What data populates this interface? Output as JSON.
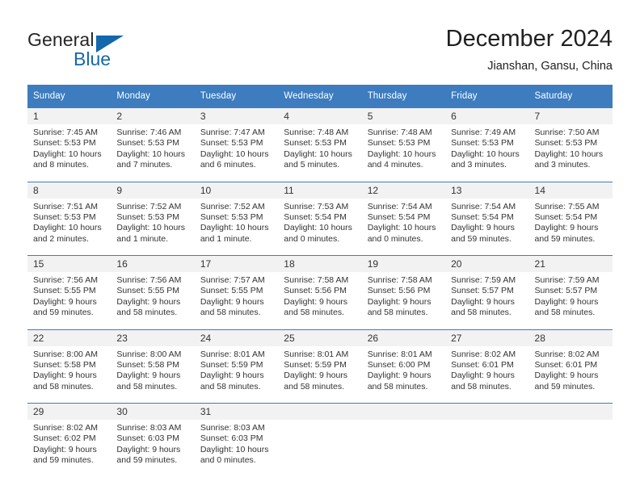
{
  "brand": {
    "name_top": "General",
    "name_bottom": "Blue",
    "triangle_color": "#1368ab"
  },
  "header": {
    "month_title": "December 2024",
    "location": "Jianshan, Gansu, China"
  },
  "theme": {
    "header_blue": "#3c7cbf",
    "daynum_background": "#f2f2f2",
    "text_color": "#333333"
  },
  "calendar": {
    "weekday_headers": [
      "Sunday",
      "Monday",
      "Tuesday",
      "Wednesday",
      "Thursday",
      "Friday",
      "Saturday"
    ],
    "weeks": [
      [
        {
          "day": "1",
          "sunrise": "Sunrise: 7:45 AM",
          "sunset": "Sunset: 5:53 PM",
          "daylight": "Daylight: 10 hours and 8 minutes."
        },
        {
          "day": "2",
          "sunrise": "Sunrise: 7:46 AM",
          "sunset": "Sunset: 5:53 PM",
          "daylight": "Daylight: 10 hours and 7 minutes."
        },
        {
          "day": "3",
          "sunrise": "Sunrise: 7:47 AM",
          "sunset": "Sunset: 5:53 PM",
          "daylight": "Daylight: 10 hours and 6 minutes."
        },
        {
          "day": "4",
          "sunrise": "Sunrise: 7:48 AM",
          "sunset": "Sunset: 5:53 PM",
          "daylight": "Daylight: 10 hours and 5 minutes."
        },
        {
          "day": "5",
          "sunrise": "Sunrise: 7:48 AM",
          "sunset": "Sunset: 5:53 PM",
          "daylight": "Daylight: 10 hours and 4 minutes."
        },
        {
          "day": "6",
          "sunrise": "Sunrise: 7:49 AM",
          "sunset": "Sunset: 5:53 PM",
          "daylight": "Daylight: 10 hours and 3 minutes."
        },
        {
          "day": "7",
          "sunrise": "Sunrise: 7:50 AM",
          "sunset": "Sunset: 5:53 PM",
          "daylight": "Daylight: 10 hours and 3 minutes."
        }
      ],
      [
        {
          "day": "8",
          "sunrise": "Sunrise: 7:51 AM",
          "sunset": "Sunset: 5:53 PM",
          "daylight": "Daylight: 10 hours and 2 minutes."
        },
        {
          "day": "9",
          "sunrise": "Sunrise: 7:52 AM",
          "sunset": "Sunset: 5:53 PM",
          "daylight": "Daylight: 10 hours and 1 minute."
        },
        {
          "day": "10",
          "sunrise": "Sunrise: 7:52 AM",
          "sunset": "Sunset: 5:53 PM",
          "daylight": "Daylight: 10 hours and 1 minute."
        },
        {
          "day": "11",
          "sunrise": "Sunrise: 7:53 AM",
          "sunset": "Sunset: 5:54 PM",
          "daylight": "Daylight: 10 hours and 0 minutes."
        },
        {
          "day": "12",
          "sunrise": "Sunrise: 7:54 AM",
          "sunset": "Sunset: 5:54 PM",
          "daylight": "Daylight: 10 hours and 0 minutes."
        },
        {
          "day": "13",
          "sunrise": "Sunrise: 7:54 AM",
          "sunset": "Sunset: 5:54 PM",
          "daylight": "Daylight: 9 hours and 59 minutes."
        },
        {
          "day": "14",
          "sunrise": "Sunrise: 7:55 AM",
          "sunset": "Sunset: 5:54 PM",
          "daylight": "Daylight: 9 hours and 59 minutes."
        }
      ],
      [
        {
          "day": "15",
          "sunrise": "Sunrise: 7:56 AM",
          "sunset": "Sunset: 5:55 PM",
          "daylight": "Daylight: 9 hours and 59 minutes."
        },
        {
          "day": "16",
          "sunrise": "Sunrise: 7:56 AM",
          "sunset": "Sunset: 5:55 PM",
          "daylight": "Daylight: 9 hours and 58 minutes."
        },
        {
          "day": "17",
          "sunrise": "Sunrise: 7:57 AM",
          "sunset": "Sunset: 5:55 PM",
          "daylight": "Daylight: 9 hours and 58 minutes."
        },
        {
          "day": "18",
          "sunrise": "Sunrise: 7:58 AM",
          "sunset": "Sunset: 5:56 PM",
          "daylight": "Daylight: 9 hours and 58 minutes."
        },
        {
          "day": "19",
          "sunrise": "Sunrise: 7:58 AM",
          "sunset": "Sunset: 5:56 PM",
          "daylight": "Daylight: 9 hours and 58 minutes."
        },
        {
          "day": "20",
          "sunrise": "Sunrise: 7:59 AM",
          "sunset": "Sunset: 5:57 PM",
          "daylight": "Daylight: 9 hours and 58 minutes."
        },
        {
          "day": "21",
          "sunrise": "Sunrise: 7:59 AM",
          "sunset": "Sunset: 5:57 PM",
          "daylight": "Daylight: 9 hours and 58 minutes."
        }
      ],
      [
        {
          "day": "22",
          "sunrise": "Sunrise: 8:00 AM",
          "sunset": "Sunset: 5:58 PM",
          "daylight": "Daylight: 9 hours and 58 minutes."
        },
        {
          "day": "23",
          "sunrise": "Sunrise: 8:00 AM",
          "sunset": "Sunset: 5:58 PM",
          "daylight": "Daylight: 9 hours and 58 minutes."
        },
        {
          "day": "24",
          "sunrise": "Sunrise: 8:01 AM",
          "sunset": "Sunset: 5:59 PM",
          "daylight": "Daylight: 9 hours and 58 minutes."
        },
        {
          "day": "25",
          "sunrise": "Sunrise: 8:01 AM",
          "sunset": "Sunset: 5:59 PM",
          "daylight": "Daylight: 9 hours and 58 minutes."
        },
        {
          "day": "26",
          "sunrise": "Sunrise: 8:01 AM",
          "sunset": "Sunset: 6:00 PM",
          "daylight": "Daylight: 9 hours and 58 minutes."
        },
        {
          "day": "27",
          "sunrise": "Sunrise: 8:02 AM",
          "sunset": "Sunset: 6:01 PM",
          "daylight": "Daylight: 9 hours and 58 minutes."
        },
        {
          "day": "28",
          "sunrise": "Sunrise: 8:02 AM",
          "sunset": "Sunset: 6:01 PM",
          "daylight": "Daylight: 9 hours and 59 minutes."
        }
      ],
      [
        {
          "day": "29",
          "sunrise": "Sunrise: 8:02 AM",
          "sunset": "Sunset: 6:02 PM",
          "daylight": "Daylight: 9 hours and 59 minutes."
        },
        {
          "day": "30",
          "sunrise": "Sunrise: 8:03 AM",
          "sunset": "Sunset: 6:03 PM",
          "daylight": "Daylight: 9 hours and 59 minutes."
        },
        {
          "day": "31",
          "sunrise": "Sunrise: 8:03 AM",
          "sunset": "Sunset: 6:03 PM",
          "daylight": "Daylight: 10 hours and 0 minutes."
        },
        {
          "day": "",
          "sunrise": "",
          "sunset": "",
          "daylight": ""
        },
        {
          "day": "",
          "sunrise": "",
          "sunset": "",
          "daylight": ""
        },
        {
          "day": "",
          "sunrise": "",
          "sunset": "",
          "daylight": ""
        },
        {
          "day": "",
          "sunrise": "",
          "sunset": "",
          "daylight": ""
        }
      ]
    ]
  }
}
